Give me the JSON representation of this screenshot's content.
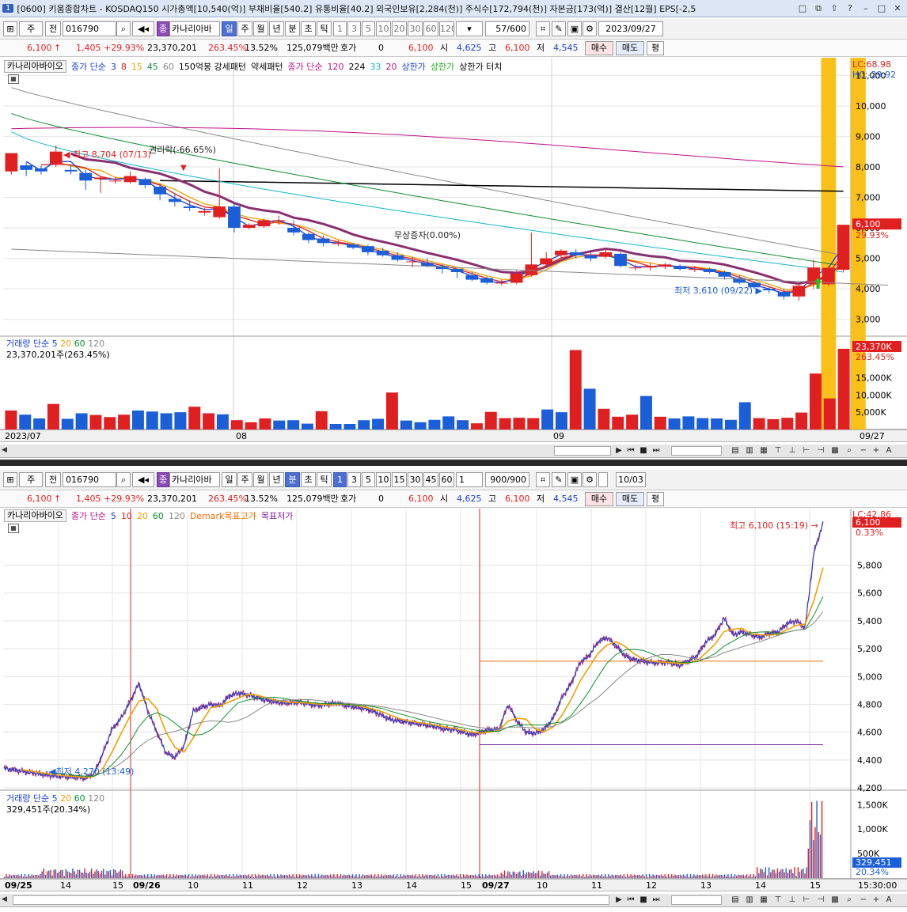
{
  "window": {
    "number": "1",
    "title": "[0600] 키움종합차트 - KOSDAQ150 시가총액[10,540(억)] 부채비율[540.2] 유통비율[40.2] 외국인보유[2,284(천)] 주식수[172,794(천)] 자본금[173(억)] 결산[12월] EPS[-2,5",
    "buttons": [
      "□",
      "⧉",
      "⇧",
      "?",
      "–",
      "□",
      "✕"
    ]
  },
  "top": {
    "toolbar": {
      "market": "주",
      "market2": "전",
      "code": "016790",
      "name_badge": "종",
      "stock_name": "카나리아바",
      "periods": [
        "일",
        "주",
        "월",
        "년",
        "분",
        "초",
        "틱"
      ],
      "selected_period": "일",
      "numbers": [
        "1",
        "3",
        "5",
        "10",
        "20",
        "30",
        "60",
        "120"
      ],
      "count": "57/600",
      "date": "2023/09/27"
    },
    "info": {
      "price": "6,100",
      "arrow": "↑",
      "change": "1,405",
      "change_pct": "+29.93%",
      "volume": "23,370,201",
      "volume_pct": "263.45%",
      "turnover": "13.52%",
      "amount": "125,079백만",
      "hoga_label": "호가",
      "hoga": "0",
      "price2": "6,100",
      "open_label": "시",
      "open": "4,625",
      "high_label": "고",
      "high": "6,100",
      "low_label": "저",
      "low": "4,545",
      "buy": "매수",
      "sell": "매도",
      "eval": "평"
    },
    "legend": {
      "name": "카나리아바이오",
      "ma_label": "종가 단순",
      "ma_values": [
        "3",
        "8",
        "15",
        "45",
        "60"
      ],
      "ma_colors": [
        "#1a3fd8",
        "#e02020",
        "#f0a000",
        "#0c9030",
        "#888888"
      ],
      "pattern1": "150억봉 강세패턴",
      "pattern2": "약세패턴",
      "ma2_label": "종가 단순",
      "ma2_values": [
        "120",
        "224",
        "33",
        "20"
      ],
      "ma2_colors": [
        "#c0108c",
        "#000000",
        "#10b8c8",
        "#c0108c"
      ],
      "limit_up": "상한가",
      "limit_up2": "상한가",
      "limit_touch": "상한가 터치"
    },
    "price_axis": {
      "lc": "LC:68.98",
      "hc": "HC:-29.92",
      "ticks": [
        "11,000",
        "10,000",
        "9,000",
        "8,000",
        "7,000",
        "6,000",
        "5,000",
        "4,000",
        "3,000"
      ],
      "cur_label": "6,100",
      "cur_pct": "29.93%"
    },
    "annotations": {
      "high": "최고 8,704 (07/13)",
      "rights": "권리락(-66.65%)",
      "bonus": "무상증자(0.00%)",
      "low": "최저 3,610 (09/22)"
    },
    "volume": {
      "label": "거래량",
      "ma_label": "단순",
      "ma_values": [
        "5",
        "20",
        "60",
        "120"
      ],
      "value_text": "23,370,201주(263.45%)",
      "ticks": [
        "15,000K",
        "10,000K",
        "5,000K"
      ],
      "cur_label": "23,370K",
      "cur_pct": "263.45%"
    },
    "xaxis": [
      "2023/07",
      "08",
      "09",
      "09/27"
    ]
  },
  "bottom": {
    "toolbar": {
      "market": "주",
      "market2": "전",
      "code": "016790",
      "name_badge": "종",
      "stock_name": "카나리아바",
      "periods": [
        "일",
        "주",
        "월",
        "년",
        "분",
        "초",
        "틱"
      ],
      "selected_period": "분",
      "numbers": [
        "1",
        "3",
        "5",
        "10",
        "15",
        "30",
        "45",
        "60"
      ],
      "selected_number": "1",
      "interval": "1",
      "count": "900/900",
      "date": "10/03"
    },
    "info": {
      "price": "6,100",
      "arrow": "↑",
      "change": "1,405",
      "change_pct": "+29.93%",
      "volume": "23,370,201",
      "volume_pct": "263.45%",
      "turnover": "13.52%",
      "amount": "125,079백만",
      "hoga_label": "호가",
      "hoga": "0",
      "price2": "6,100",
      "open_label": "시",
      "open": "4,625",
      "high_label": "고",
      "high": "6,100",
      "low_label": "저",
      "low": "4,545",
      "buy": "매수",
      "sell": "매도",
      "eval": "평"
    },
    "legend": {
      "name": "카나리아바이오",
      "ma_label": "종가 단순",
      "ma_values": [
        "5",
        "10",
        "20",
        "60",
        "120"
      ],
      "ma_colors": [
        "#1a3fd8",
        "#e02020",
        "#f0a000",
        "#0c9030",
        "#888888"
      ],
      "demark_high": "Demark목표고가",
      "demark_low": "목표저가"
    },
    "price_axis": {
      "lc": "LC:42.86",
      "cur_label": "6,100",
      "cur_pct": "0.33%",
      "ticks": [
        "5,800",
        "5,600",
        "5,400",
        "5,200",
        "5,000",
        "4,800",
        "4,600",
        "4,400",
        "4,200"
      ]
    },
    "annotations": {
      "high": "최고 6,100 (15:19)",
      "low": "최저 4,270 (13:49)"
    },
    "volume": {
      "label": "거래량",
      "ma_label": "단순",
      "ma_values": [
        "5",
        "20",
        "60",
        "120"
      ],
      "value_text": "329,451주(20.34%)",
      "ticks": [
        "1,500K",
        "1,000K",
        "500K"
      ],
      "cur_label": "329,451",
      "cur_pct": "20.34%"
    },
    "xaxis": [
      "09/25",
      "14",
      "15",
      "09/26",
      "10",
      "11",
      "12",
      "13",
      "14",
      "15",
      "09/27",
      "10",
      "11",
      "12",
      "13",
      "14",
      "15",
      "15:30:00"
    ]
  },
  "colors": {
    "up": "#e02020",
    "down": "#1a5fd8",
    "highlight": "#f8c018"
  },
  "chart_data": [
    {
      "type": "candlestick",
      "title": "",
      "period": "daily",
      "categories_start": "2023/07",
      "ylim": [
        2500,
        11500
      ],
      "candles": [
        [
          7850,
          8450,
          7750,
          8350
        ],
        [
          8050,
          7900,
          7700,
          8150
        ],
        [
          7950,
          7850,
          7750,
          8050
        ],
        [
          8100,
          8500,
          8000,
          8704
        ],
        [
          7900,
          7850,
          7750,
          8050
        ],
        [
          7800,
          7550,
          7250,
          7900
        ],
        [
          7600,
          7650,
          7150,
          7700
        ],
        [
          7550,
          7550,
          7450,
          7650
        ],
        [
          7500,
          7700,
          7450,
          7850
        ],
        [
          7600,
          7400,
          7300,
          7650
        ],
        [
          7350,
          7100,
          6900,
          7450
        ],
        [
          6950,
          6850,
          6700,
          7100
        ],
        [
          6700,
          6650,
          6550,
          6900
        ],
        [
          6500,
          6550,
          6400,
          6650
        ],
        [
          6350,
          6700,
          6300,
          7950
        ],
        [
          6700,
          6000,
          5850,
          6850
        ],
        [
          6000,
          6100,
          5950,
          6150
        ],
        [
          6050,
          6250,
          6000,
          6300
        ],
        [
          6250,
          6250,
          6100,
          6400
        ],
        [
          6000,
          5850,
          5750,
          6250
        ],
        [
          5800,
          5600,
          5500,
          5850
        ],
        [
          5650,
          5500,
          5400,
          5750
        ],
        [
          5500,
          5500,
          5400,
          5600
        ],
        [
          5450,
          5350,
          5300,
          5500
        ],
        [
          5400,
          5200,
          5100,
          5450
        ],
        [
          5250,
          5100,
          5050,
          5350
        ],
        [
          5100,
          4950,
          4900,
          5200
        ],
        [
          4900,
          4900,
          4700,
          5050
        ],
        [
          4850,
          4750,
          4700,
          5000
        ],
        [
          4750,
          4650,
          4500,
          4800
        ],
        [
          4650,
          4550,
          4350,
          4650
        ],
        [
          4450,
          4300,
          4250,
          4550
        ],
        [
          4350,
          4200,
          4150,
          4400
        ],
        [
          4200,
          4200,
          4100,
          4300
        ],
        [
          4200,
          4500,
          4150,
          4600
        ],
        [
          4450,
          4800,
          4400,
          5850
        ],
        [
          4800,
          5000,
          4700,
          5200
        ],
        [
          5100,
          5250,
          5000,
          5300
        ],
        [
          5200,
          5100,
          5000,
          5300
        ],
        [
          5100,
          5000,
          4900,
          5200
        ],
        [
          5050,
          5200,
          5000,
          5350
        ],
        [
          5150,
          4750,
          4700,
          5200
        ],
        [
          4700,
          4700,
          4600,
          4800
        ],
        [
          4700,
          4750,
          4600,
          4850
        ],
        [
          4750,
          4800,
          4650,
          4850
        ],
        [
          4750,
          4650,
          4600,
          4800
        ],
        [
          4650,
          4650,
          4550,
          4750
        ],
        [
          4650,
          4550,
          4500,
          4700
        ],
        [
          4550,
          4400,
          4300,
          4600
        ],
        [
          4350,
          4200,
          4150,
          4450
        ],
        [
          4200,
          4050,
          4000,
          4250
        ],
        [
          4000,
          3950,
          3850,
          4050
        ],
        [
          3900,
          3750,
          3650,
          4000
        ],
        [
          3750,
          4100,
          3610,
          4200
        ],
        [
          4150,
          4700,
          4000,
          4950
        ],
        [
          4150,
          4690,
          4100,
          4750
        ],
        [
          4625,
          6100,
          4545,
          6100
        ]
      ],
      "volume_k": [
        5500,
        4300,
        3200,
        7400,
        3100,
        4700,
        4200,
        3600,
        4300,
        5500,
        5200,
        4700,
        5000,
        6600,
        4700,
        4400,
        2700,
        2100,
        3200,
        2600,
        2700,
        1700,
        5300,
        1600,
        1600,
        2700,
        3100,
        10700,
        2600,
        2100,
        2800,
        3800,
        2700,
        1800,
        5100,
        3300,
        3400,
        3300,
        5800,
        5000,
        23000,
        11800,
        6000,
        3700,
        4300,
        9700,
        3700,
        3200,
        3800,
        3300,
        3200,
        2800,
        7900,
        3300,
        3000,
        3400,
        4900,
        16200,
        9000,
        23370
      ],
      "limit_up_days": [
        55,
        57
      ]
    },
    {
      "type": "candlestick",
      "title": "",
      "period": "1-minute",
      "sessions": [
        "09/25",
        "09/26",
        "09/27"
      ],
      "ylim": [
        4200,
        6150
      ],
      "close_path": [
        4340,
        4330,
        4320,
        4310,
        4300,
        4290,
        4285,
        4280,
        4275,
        4270,
        4300,
        4450,
        4620,
        4700,
        4820,
        4950,
        4750,
        4600,
        4450,
        4420,
        4500,
        4750,
        4780,
        4800,
        4790,
        4860,
        4880,
        4870,
        4850,
        4830,
        4820,
        4810,
        4810,
        4815,
        4800,
        4790,
        4800,
        4810,
        4790,
        4780,
        4770,
        4750,
        4720,
        4690,
        4680,
        4670,
        4660,
        4650,
        4640,
        4620,
        4620,
        4600,
        4580,
        4600,
        4620,
        4620,
        4800,
        4680,
        4600,
        4590,
        4620,
        4700,
        4850,
        4950,
        5100,
        5150,
        5250,
        5280,
        5220,
        5150,
        5120,
        5110,
        5100,
        5100,
        5100,
        5080,
        5110,
        5150,
        5250,
        5300,
        5420,
        5300,
        5320,
        5300,
        5280,
        5310,
        5320,
        5380,
        5400,
        5350,
        5900,
        6100
      ],
      "demark_high": 5110,
      "demark_low": 4510,
      "volume_peak_k": 1600
    }
  ]
}
